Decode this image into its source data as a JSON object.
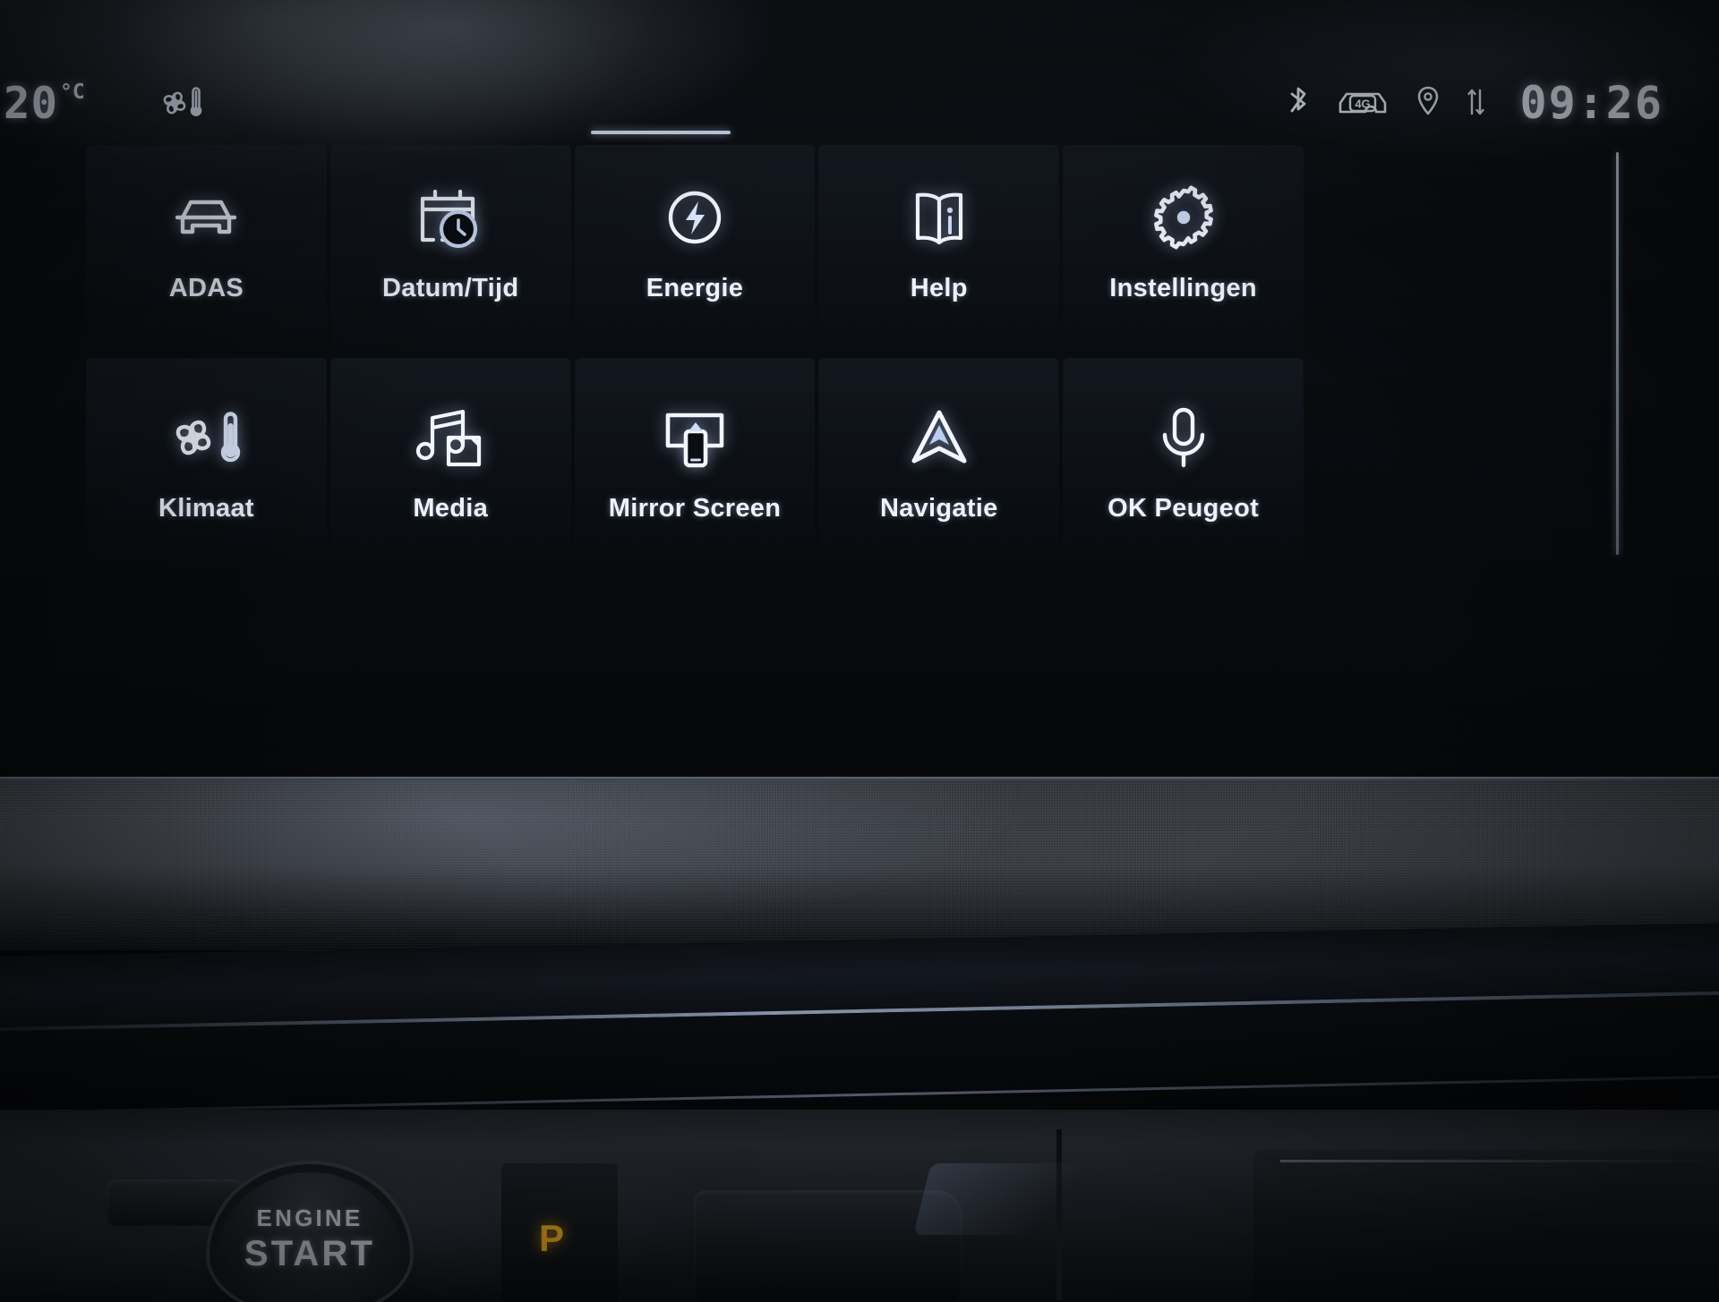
{
  "statusbar": {
    "temperature": "20",
    "temperature_unit": "°C",
    "climate_icon": "fan-thermometer-icon",
    "bluetooth_icon": "bluetooth-icon",
    "connectivity_icon": "car-4g-icon",
    "connectivity_label": "4G",
    "location_icon": "location-pin-icon",
    "data_transfer_icon": "data-up-down-arrows-icon",
    "clock": "09:26"
  },
  "menu": {
    "page_indicator": "page-1-active",
    "tiles": [
      {
        "label": "ADAS",
        "icon": "car-front-icon"
      },
      {
        "label": "Datum/Tijd",
        "icon": "calendar-clock-icon"
      },
      {
        "label": "Energie",
        "icon": "lightning-bolt-circle-icon"
      },
      {
        "label": "Help",
        "icon": "open-book-info-icon"
      },
      {
        "label": "Instellingen",
        "icon": "gear-icon"
      },
      {
        "label": "Klimaat",
        "icon": "fan-thermometer-icon"
      },
      {
        "label": "Media",
        "icon": "music-note-media-icon"
      },
      {
        "label": "Mirror Screen",
        "icon": "screen-mirroring-icon"
      },
      {
        "label": "Navigatie",
        "icon": "navigation-arrow-icon"
      },
      {
        "label": "OK Peugeot",
        "icon": "microphone-icon"
      }
    ]
  },
  "console": {
    "start_button_line1": "ENGINE",
    "start_button_line2": "START",
    "gear_indicator": "P"
  },
  "colors": {
    "screen_text": "#eef3fb",
    "accent_glow": "#bcd4f8",
    "gear_amber": "#f3b11e",
    "screen_bg": "#07090c"
  }
}
